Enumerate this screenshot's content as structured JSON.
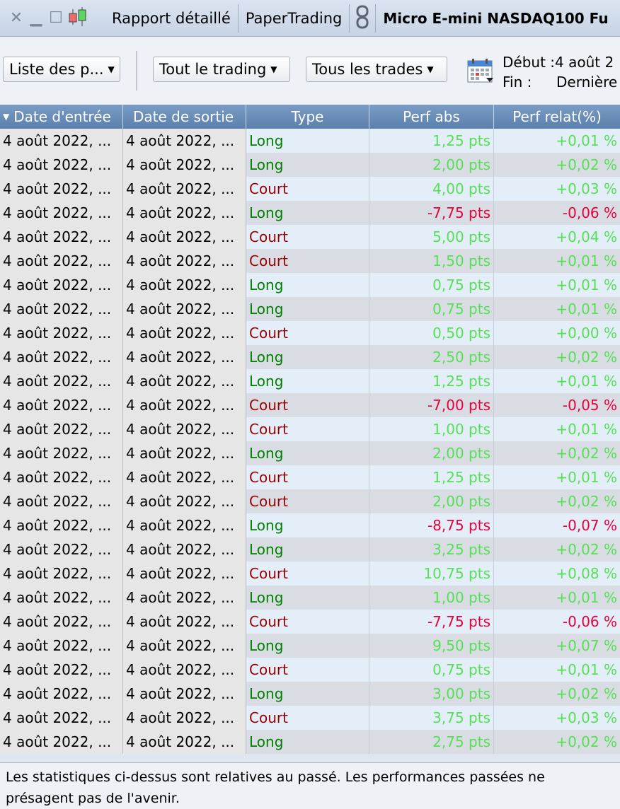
{
  "titlebar": {
    "icons": [
      "close-icon",
      "minimize-icon",
      "maximize-icon",
      "candlestick-icon",
      "link-icon"
    ],
    "report_label": "Rapport détaillé",
    "account_label": "PaperTrading",
    "instrument_title": "Micro E-mini NASDAQ100 Fu"
  },
  "toolbar": {
    "list_dropdown": "Liste des p...",
    "trading_dropdown": "Tout le trading",
    "trades_dropdown": "Tous les trades",
    "start_label": "Début :",
    "start_value": "4 août 2",
    "end_label": "Fin :",
    "end_value": "Dernière"
  },
  "table": {
    "columns": [
      "Date d'entrée",
      "Date de sortie",
      "Type",
      "Perf abs",
      "Perf relat(%)"
    ],
    "rows": [
      {
        "entry": "4 août 2022, ...",
        "exit": "4 août 2022, ...",
        "type": "Long",
        "abs": "1,25 pts",
        "rel": "+0,01 %"
      },
      {
        "entry": "4 août 2022, ...",
        "exit": "4 août 2022, ...",
        "type": "Long",
        "abs": "2,00 pts",
        "rel": "+0,02 %"
      },
      {
        "entry": "4 août 2022, ...",
        "exit": "4 août 2022, ...",
        "type": "Court",
        "abs": "4,00 pts",
        "rel": "+0,03 %"
      },
      {
        "entry": "4 août 2022, ...",
        "exit": "4 août 2022, ...",
        "type": "Long",
        "abs": "-7,75 pts",
        "rel": "-0,06 %"
      },
      {
        "entry": "4 août 2022, ...",
        "exit": "4 août 2022, ...",
        "type": "Court",
        "abs": "5,00 pts",
        "rel": "+0,04 %"
      },
      {
        "entry": "4 août 2022, ...",
        "exit": "4 août 2022, ...",
        "type": "Court",
        "abs": "1,50 pts",
        "rel": "+0,01 %"
      },
      {
        "entry": "4 août 2022, ...",
        "exit": "4 août 2022, ...",
        "type": "Long",
        "abs": "0,75 pts",
        "rel": "+0,01 %"
      },
      {
        "entry": "4 août 2022, ...",
        "exit": "4 août 2022, ...",
        "type": "Long",
        "abs": "0,75 pts",
        "rel": "+0,01 %"
      },
      {
        "entry": "4 août 2022, ...",
        "exit": "4 août 2022, ...",
        "type": "Court",
        "abs": "0,50 pts",
        "rel": "+0,00 %"
      },
      {
        "entry": "4 août 2022, ...",
        "exit": "4 août 2022, ...",
        "type": "Long",
        "abs": "2,50 pts",
        "rel": "+0,02 %"
      },
      {
        "entry": "4 août 2022, ...",
        "exit": "4 août 2022, ...",
        "type": "Long",
        "abs": "1,25 pts",
        "rel": "+0,01 %"
      },
      {
        "entry": "4 août 2022, ...",
        "exit": "4 août 2022, ...",
        "type": "Court",
        "abs": "-7,00 pts",
        "rel": "-0,05 %"
      },
      {
        "entry": "4 août 2022, ...",
        "exit": "4 août 2022, ...",
        "type": "Court",
        "abs": "1,00 pts",
        "rel": "+0,01 %"
      },
      {
        "entry": "4 août 2022, ...",
        "exit": "4 août 2022, ...",
        "type": "Long",
        "abs": "2,00 pts",
        "rel": "+0,02 %"
      },
      {
        "entry": "4 août 2022, ...",
        "exit": "4 août 2022, ...",
        "type": "Court",
        "abs": "1,25 pts",
        "rel": "+0,01 %"
      },
      {
        "entry": "4 août 2022, ...",
        "exit": "4 août 2022, ...",
        "type": "Court",
        "abs": "2,00 pts",
        "rel": "+0,02 %"
      },
      {
        "entry": "4 août 2022, ...",
        "exit": "4 août 2022, ...",
        "type": "Long",
        "abs": "-8,75 pts",
        "rel": "-0,07 %"
      },
      {
        "entry": "4 août 2022, ...",
        "exit": "4 août 2022, ...",
        "type": "Long",
        "abs": "3,25 pts",
        "rel": "+0,02 %"
      },
      {
        "entry": "4 août 2022, ...",
        "exit": "4 août 2022, ...",
        "type": "Court",
        "abs": "10,75 pts",
        "rel": "+0,08 %"
      },
      {
        "entry": "4 août 2022, ...",
        "exit": "4 août 2022, ...",
        "type": "Long",
        "abs": "1,00 pts",
        "rel": "+0,01 %"
      },
      {
        "entry": "4 août 2022, ...",
        "exit": "4 août 2022, ...",
        "type": "Court",
        "abs": "-7,75 pts",
        "rel": "-0,06 %"
      },
      {
        "entry": "4 août 2022, ...",
        "exit": "4 août 2022, ...",
        "type": "Long",
        "abs": "9,50 pts",
        "rel": "+0,07 %"
      },
      {
        "entry": "4 août 2022, ...",
        "exit": "4 août 2022, ...",
        "type": "Court",
        "abs": "0,75 pts",
        "rel": "+0,01 %"
      },
      {
        "entry": "4 août 2022, ...",
        "exit": "4 août 2022, ...",
        "type": "Long",
        "abs": "3,00 pts",
        "rel": "+0,02 %"
      },
      {
        "entry": "4 août 2022, ...",
        "exit": "4 août 2022, ...",
        "type": "Court",
        "abs": "3,75 pts",
        "rel": "+0,03 %"
      },
      {
        "entry": "4 août 2022, ...",
        "exit": "4 août 2022, ...",
        "type": "Long",
        "abs": "2,75 pts",
        "rel": "+0,02 %"
      }
    ]
  },
  "footer": {
    "disclaimer": "Les statistiques ci-dessus sont relatives au passé. Les performances passées ne présagent pas de l'avenir."
  },
  "colors": {
    "long": "#008000",
    "court": "#9b0000",
    "positive": "#55e055",
    "negative": "#e8003a",
    "header": "#6a8eba"
  }
}
